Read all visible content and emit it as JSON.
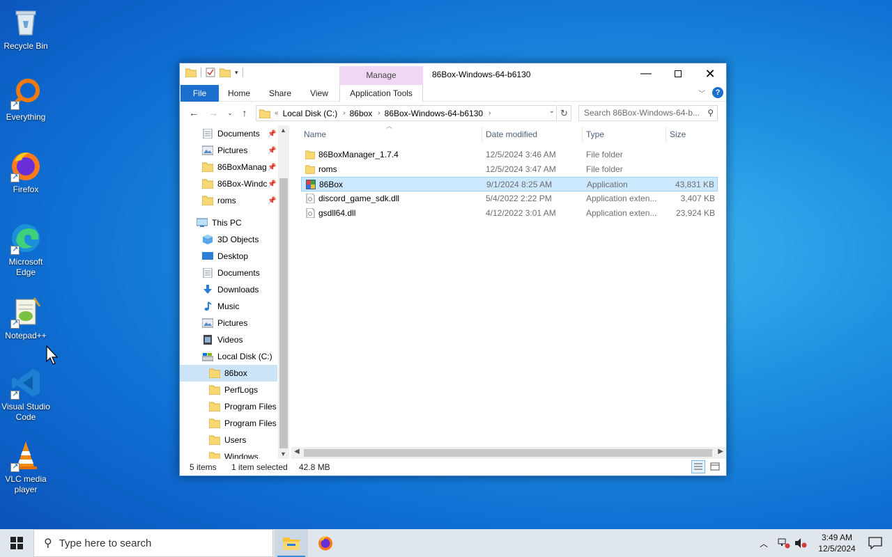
{
  "desktop": {
    "icons": [
      {
        "label": "Recycle Bin"
      },
      {
        "label": "Everything"
      },
      {
        "label": "Firefox"
      },
      {
        "label": "Microsoft Edge"
      },
      {
        "label": "Notepad++"
      },
      {
        "label": "Visual Studio Code"
      },
      {
        "label": "VLC media player"
      }
    ]
  },
  "window": {
    "title": "86Box-Windows-64-b6130",
    "context_tab": "Manage",
    "ribbon_tabs": [
      "File",
      "Home",
      "Share",
      "View",
      "Application Tools"
    ],
    "help_label": "?",
    "address": {
      "overflow": "«",
      "crumbs": [
        "Local Disk (C:)",
        "86box",
        "86Box-Windows-64-b6130"
      ]
    },
    "search_placeholder": "Search 86Box-Windows-64-b...",
    "navpane": {
      "quick_access": [
        {
          "label": "Documents",
          "icon": "documents-icon",
          "pinned": true
        },
        {
          "label": "Pictures",
          "icon": "pictures-icon",
          "pinned": true
        },
        {
          "label": "86BoxManag",
          "icon": "folder-icon",
          "pinned": true
        },
        {
          "label": "86Box-Windc",
          "icon": "folder-icon",
          "pinned": true
        },
        {
          "label": "roms",
          "icon": "folder-icon",
          "pinned": true
        }
      ],
      "this_pc": "This PC",
      "this_pc_items": [
        {
          "label": "3D Objects",
          "icon": "3d-objects-icon"
        },
        {
          "label": "Desktop",
          "icon": "desktop-icon"
        },
        {
          "label": "Documents",
          "icon": "documents-icon"
        },
        {
          "label": "Downloads",
          "icon": "downloads-icon"
        },
        {
          "label": "Music",
          "icon": "music-icon"
        },
        {
          "label": "Pictures",
          "icon": "pictures-icon"
        },
        {
          "label": "Videos",
          "icon": "videos-icon"
        },
        {
          "label": "Local Disk (C:)",
          "icon": "drive-icon"
        }
      ],
      "drive_items": [
        {
          "label": "86box",
          "selected": true
        },
        {
          "label": "PerfLogs"
        },
        {
          "label": "Program Files"
        },
        {
          "label": "Program Files ("
        },
        {
          "label": "Users"
        },
        {
          "label": "Windows"
        }
      ]
    },
    "columns": [
      "Name",
      "Date modified",
      "Type",
      "Size"
    ],
    "files": [
      {
        "name": "86BoxManager_1.7.4",
        "date": "12/5/2024 3:46 AM",
        "type": "File folder",
        "size": "",
        "icon": "folder-icon"
      },
      {
        "name": "roms",
        "date": "12/5/2024 3:47 AM",
        "type": "File folder",
        "size": "",
        "icon": "folder-icon"
      },
      {
        "name": "86Box",
        "date": "9/1/2024 8:25 AM",
        "type": "Application",
        "size": "43,831 KB",
        "icon": "app-86box-icon",
        "selected": true
      },
      {
        "name": "discord_game_sdk.dll",
        "date": "5/4/2022 2:22 PM",
        "type": "Application exten...",
        "size": "3,407 KB",
        "icon": "dll-icon"
      },
      {
        "name": "gsdll64.dll",
        "date": "4/12/2022 3:01 AM",
        "type": "Application exten...",
        "size": "23,924 KB",
        "icon": "dll-icon"
      }
    ],
    "status": {
      "items": "5 items",
      "selected": "1 item selected",
      "size": "42.8 MB"
    }
  },
  "taskbar": {
    "search_placeholder": "Type here to search",
    "time": "3:49 AM",
    "date": "12/5/2024"
  },
  "colors": {
    "accent": "#1a6fcf",
    "selection": "#cce8ff",
    "manage_tab": "#f0d8f5"
  }
}
